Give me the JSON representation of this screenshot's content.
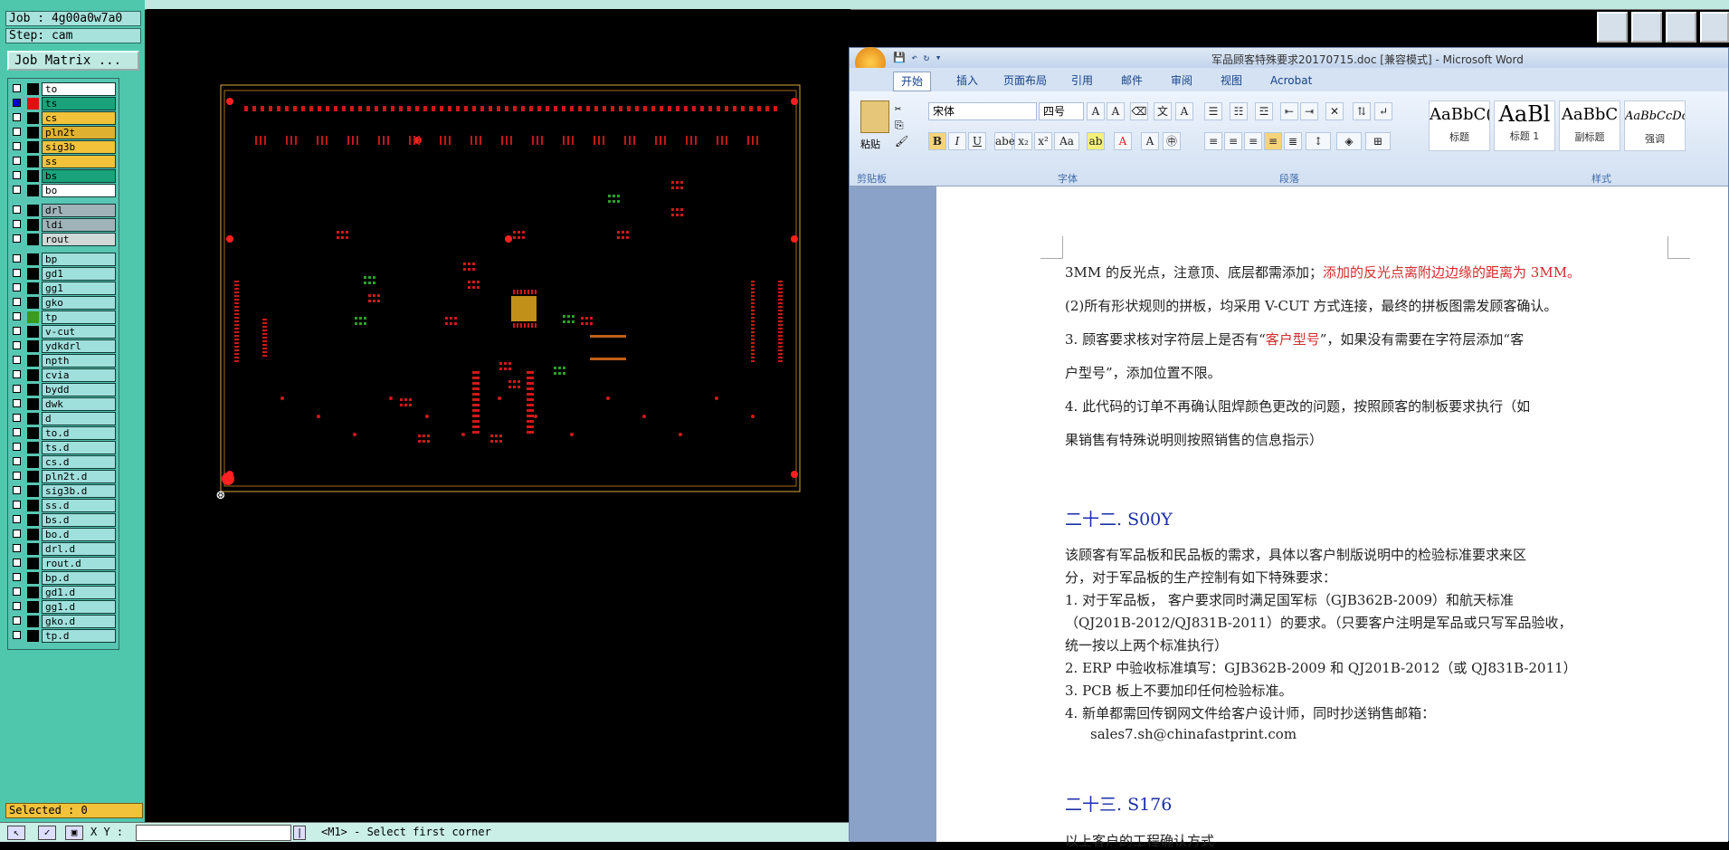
{
  "cam": {
    "job_label": "Job : 4g00a0w7a0",
    "step_label": "Step: cam",
    "job_matrix_button": "Job Matrix ...",
    "selected_label": "Selected : 0",
    "xy_label": "X Y :",
    "status_text": "<M1> - Select first corner",
    "layers": [
      {
        "name": "to",
        "color": "#ffffff",
        "swatch": "#000000"
      },
      {
        "name": "ts",
        "color": "#1aa37a",
        "swatch": "#e01010",
        "swatch2": "#0000cc"
      },
      {
        "name": "cs",
        "color": "#f2c23b",
        "swatch": "#000000"
      },
      {
        "name": "pln2t",
        "color": "#e0b030",
        "swatch": "#000000"
      },
      {
        "name": "sig3b",
        "color": "#f2c23b",
        "swatch": "#000000"
      },
      {
        "name": "ss",
        "color": "#f2c23b",
        "swatch": "#000000"
      },
      {
        "name": "bs",
        "color": "#1aa37a",
        "swatch": "#000000"
      },
      {
        "name": "bo",
        "color": "#ffffff",
        "swatch": "#000000"
      },
      {
        "name": "drl",
        "color": "#9fb3b8",
        "swatch": "#000000"
      },
      {
        "name": "ldi",
        "color": "#9fb3b8",
        "swatch": "#000000"
      },
      {
        "name": "rout",
        "color": "#d0d8d8",
        "swatch": "#000000"
      },
      {
        "name": "bp",
        "color": "#9fe0dc",
        "swatch": "#000000"
      },
      {
        "name": "gd1",
        "color": "#9fe0dc",
        "swatch": "#000000"
      },
      {
        "name": "gg1",
        "color": "#9fe0dc",
        "swatch": "#000000"
      },
      {
        "name": "gko",
        "color": "#9fe0dc",
        "swatch": "#000000"
      },
      {
        "name": "tp",
        "color": "#9fe0dc",
        "swatch": "#3a9a1a"
      },
      {
        "name": "v-cut",
        "color": "#9fe0dc",
        "swatch": "#000000"
      },
      {
        "name": "ydkdrl",
        "color": "#9fe0dc",
        "swatch": "#000000"
      },
      {
        "name": "npth",
        "color": "#9fe0dc",
        "swatch": "#000000"
      },
      {
        "name": "cvia",
        "color": "#9fe0dc",
        "swatch": "#000000"
      },
      {
        "name": "bydd",
        "color": "#9fe0dc",
        "swatch": "#000000"
      },
      {
        "name": "dwk",
        "color": "#9fe0dc",
        "swatch": "#000000"
      },
      {
        "name": "d",
        "color": "#9fe0dc",
        "swatch": "#000000"
      },
      {
        "name": "to.d",
        "color": "#9fe0dc",
        "swatch": "#000000"
      },
      {
        "name": "ts.d",
        "color": "#9fe0dc",
        "swatch": "#000000"
      },
      {
        "name": "cs.d",
        "color": "#9fe0dc",
        "swatch": "#000000"
      },
      {
        "name": "pln2t.d",
        "color": "#9fe0dc",
        "swatch": "#000000"
      },
      {
        "name": "sig3b.d",
        "color": "#9fe0dc",
        "swatch": "#000000"
      },
      {
        "name": "ss.d",
        "color": "#9fe0dc",
        "swatch": "#000000"
      },
      {
        "name": "bs.d",
        "color": "#9fe0dc",
        "swatch": "#000000"
      },
      {
        "name": "bo.d",
        "color": "#9fe0dc",
        "swatch": "#000000"
      },
      {
        "name": "drl.d",
        "color": "#9fe0dc",
        "swatch": "#000000"
      },
      {
        "name": "rout.d",
        "color": "#9fe0dc",
        "swatch": "#000000"
      },
      {
        "name": "bp.d",
        "color": "#9fe0dc",
        "swatch": "#000000"
      },
      {
        "name": "gd1.d",
        "color": "#9fe0dc",
        "swatch": "#000000"
      },
      {
        "name": "gg1.d",
        "color": "#9fe0dc",
        "swatch": "#000000"
      },
      {
        "name": "gko.d",
        "color": "#9fe0dc",
        "swatch": "#000000"
      },
      {
        "name": "tp.d",
        "color": "#9fe0dc",
        "swatch": "#000000"
      }
    ]
  },
  "word": {
    "title": "军品顾客特殊要求20170715.doc [兼容模式] - Microsoft Word",
    "tabs": [
      "开始",
      "插入",
      "页面布局",
      "引用",
      "邮件",
      "审阅",
      "视图",
      "Acrobat"
    ],
    "paste_label": "粘贴",
    "clipboard_label": "剪贴板",
    "font_group_label": "字体",
    "paragraph_group_label": "段落",
    "styles_group_label": "样式",
    "font_name": "宋体",
    "font_size": "四号",
    "styles": [
      {
        "preview": "AaBbC(",
        "caption": "标题"
      },
      {
        "preview": "AaBl",
        "caption": "标题 1"
      },
      {
        "preview": "AaBbC",
        "caption": "副标题"
      },
      {
        "preview": "AaBbCcDc",
        "caption": "强调"
      }
    ],
    "doc": {
      "line1_a": "3MM 的反光点，注意顶、底层都需添加；",
      "line1_b": "添加的反光点离附边边缘的距离为 3MM。",
      "line2": "(2)所有形状规则的拼板，均采用 V-CUT 方式连接，最终的拼板图需发顾客确认。",
      "line3_a": "3.  顾客要求核对字符层上是否有“",
      "line3_b": "客户型号",
      "line3_c": "”，如果没有需要在字符层添加“客",
      "line4": "户型号”，添加位置不限。",
      "line5": "4.  此代码的订单不再确认阻焊颜色更改的问题，按照顾客的制板要求执行（如",
      "line6": "果销售有特殊说明则按照销售的信息指示）",
      "heading1": "二十二. S00Y",
      "p1": "该顾客有军品板和民品板的需求，具体以客户制版说明中的检验标准要求来区",
      "p2": "分，对于军品板的生产控制有如下特殊要求：",
      "p3": "1. 对于军品板， 客户要求同时满足国军标（GJB362B-2009）和航天标准",
      "p4": "（QJ201B-2012/QJ831B-2011）的要求。（只要客户注明是军品或只写军品验收，",
      "p5": "统一按以上两个标准执行）",
      "p6": "2. ERP 中验收标准填写：GJB362B-2009 和 QJ201B-2012（或 QJ831B-2011）",
      "p7": "3. PCB 板上不要加印任何检验标准。",
      "p8": "4. 新单都需回传钢网文件给客户设计师，同时抄送销售邮箱：",
      "p9": "sales7.sh@chinafastprint.com",
      "heading2": "二十三. S176",
      "p10": "以上客户的工程确认方式"
    }
  }
}
